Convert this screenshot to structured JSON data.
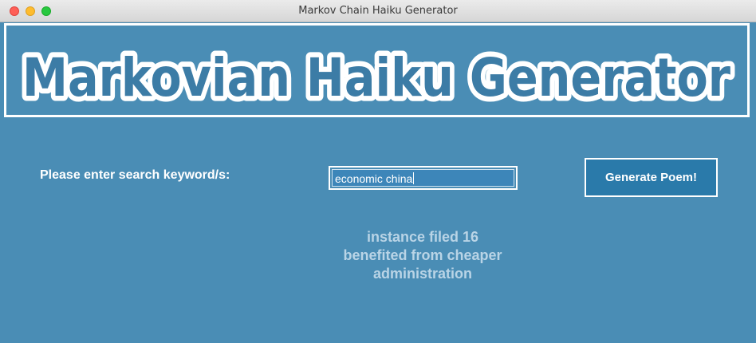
{
  "window": {
    "title": "Markov Chain Haiku Generator"
  },
  "banner": {
    "title": "Markovian Haiku Generator"
  },
  "form": {
    "label": "Please enter search keyword/s:",
    "input_value": "economic china",
    "button_label": "Generate Poem!"
  },
  "poem": {
    "lines": [
      "instance filed 16",
      "benefited from cheaper",
      "administration"
    ]
  },
  "colors": {
    "background": "#4a8db5",
    "button": "#2a7aaa",
    "title_fill": "#3c7ca6",
    "poem_text": "#b9d4e6"
  }
}
